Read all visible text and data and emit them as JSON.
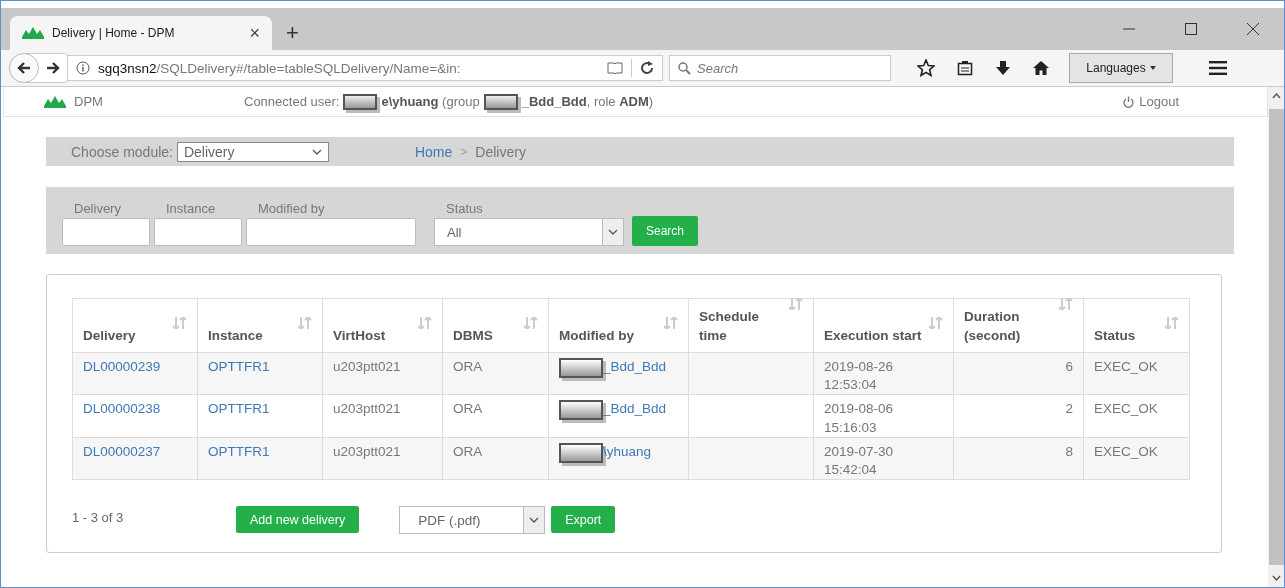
{
  "browser": {
    "tab_title": "Delivery | Home - DPM",
    "tab_close": "×",
    "new_tab": "+",
    "url_host": "sgq3nsn2",
    "url_path": "/SQLDelivery#/table=tableSQLDelivery/Name=&in:",
    "search_placeholder": "Search",
    "languages_button": "Languages"
  },
  "header": {
    "app_name": "DPM",
    "user_prefix": "Connected user:",
    "user_suffix": "**e\\yhuang** (group",
    "group_text": "**_Bdd_Bdd**, role **ADM**)",
    "logout": "Logout"
  },
  "module_bar": {
    "label": "Choose module:",
    "module": "Delivery",
    "breadcrumb": [
      {
        "text": "Home",
        "kind": "link"
      },
      {
        "text": ">",
        "kind": "separator"
      },
      {
        "text": "Delivery",
        "kind": "current"
      }
    ]
  },
  "filters": {
    "fields": [
      {
        "label": "Delivery",
        "kind": "text"
      },
      {
        "label": "Instance",
        "kind": "text"
      },
      {
        "label": "Modified by",
        "kind": "text"
      },
      {
        "label": "Status",
        "kind": "select",
        "value": "All"
      }
    ],
    "search_button": "Search"
  },
  "table": {
    "columns": [
      {
        "label": "Delivery"
      },
      {
        "label": "Instance"
      },
      {
        "label": "VirtHost"
      },
      {
        "label": "DBMS"
      },
      {
        "label": "Modified by"
      },
      {
        "label": "Schedule time"
      },
      {
        "label": "Execution start"
      },
      {
        "label": "Duration (second)"
      },
      {
        "label": "Status"
      }
    ],
    "rows": [
      {
        "delivery": "DL00000239",
        "instance": "OPTTFR1",
        "virthost": "u203ptt021",
        "dbms": "ORA",
        "modified_by": "_Bdd_Bdd",
        "execution_start": "2019-08-26 12:53:04",
        "duration": "6",
        "status": "EXEC_OK"
      },
      {
        "delivery": "DL00000238",
        "instance": "OPTTFR1",
        "virthost": "u203ptt021",
        "dbms": "ORA",
        "modified_by": "_Bdd_Bdd",
        "execution_start": "2019-08-06 15:16:03",
        "duration": "2",
        "status": "EXEC_OK"
      },
      {
        "delivery": "DL00000237",
        "instance": "OPTTFR1",
        "virthost": "u203ptt021",
        "dbms": "ORA",
        "modified_by": "\\yhuang",
        "execution_start": "2019-07-30 15:42:04",
        "duration": "8",
        "status": "EXEC_OK"
      }
    ]
  },
  "footer": {
    "range": "1 - 3 of 3",
    "add_button": "Add new delivery",
    "format": "PDF (.pdf)",
    "export_button": "Export"
  }
}
